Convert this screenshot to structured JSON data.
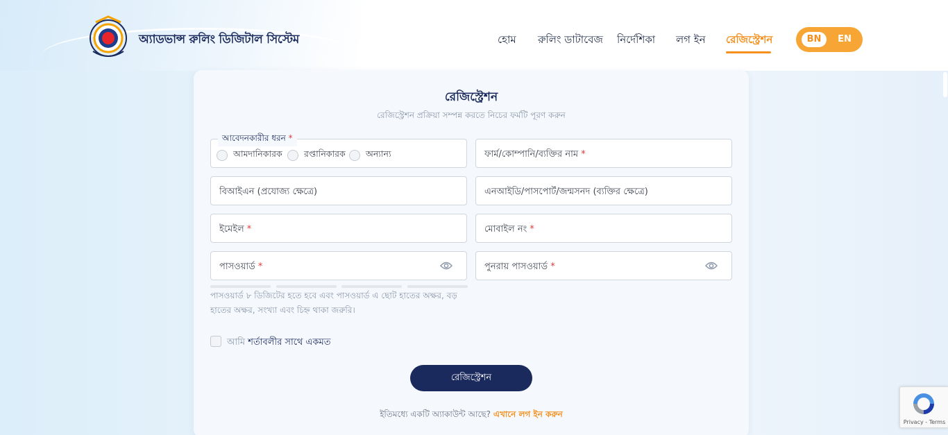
{
  "header": {
    "brand": "অ্যাডভান্স রুলিং ডিজিটাল সিস্টেম",
    "logo_alt": "BANGLADESH CUSTOMS & VAT",
    "nav": [
      {
        "label": "হোম"
      },
      {
        "label": "রুলিং ডাটাবেজ"
      },
      {
        "label": "নির্দেশিকা"
      },
      {
        "label": "লগ ইন"
      },
      {
        "label": "রেজিস্ট্রেশন",
        "active": true
      }
    ],
    "lang": {
      "bn": "BN",
      "en": "EN",
      "selected": "BN"
    }
  },
  "form": {
    "title": "রেজিস্ট্রেশন",
    "subtitle": "রেজিস্ট্রেশন প্রক্রিয়া সম্পন্ন করতে নিচের ফর্মটি পূরণ করুন",
    "applicant_type": {
      "legend": "আবেদনকারীর ধরন",
      "required": "*",
      "options": [
        "আমদানিকারক",
        "রপ্তানিকারক",
        "অন্যান্য"
      ]
    },
    "fields": {
      "name": {
        "label": "ফার্ম/কোম্পানি/ব্যক্তির নাম",
        "required": "*"
      },
      "bin": {
        "label": "বিআইএন (প্রযোজ্য ক্ষেত্রে)"
      },
      "nid": {
        "label": "এনআইডি/পাসপোর্ট/জন্মসনদ (ব্যক্তির ক্ষেত্রে)"
      },
      "email": {
        "label": "ইমেইল",
        "required": "*"
      },
      "mobile": {
        "label": "মোবাইল নং",
        "required": "*"
      },
      "password": {
        "label": "পাসওয়ার্ড",
        "required": "*"
      },
      "confirm_password": {
        "label": "পুনরায় পাসওয়ার্ড",
        "required": "*"
      }
    },
    "password_hint": "পাসওয়ার্ড ৮ ডিজিটের হতে হবে এবং পাসওয়ার্ড এ ছোট হাতের অক্ষর, বড় হাতের অক্ষর, সংখ্যা এবং চিহ্ন থাকা জরুরি।",
    "agree": {
      "prefix": "আমি",
      "link": "শর্তাবলীর সাথে একমত"
    },
    "submit": "রেজিস্ট্রেশন",
    "login_prompt": "ইতিমধ্যে একটি অ্যাকাউন্ট আছে?",
    "login_link": "এখানে লগ ইন করুন"
  },
  "recaptcha": {
    "text": "Privacy - Terms"
  },
  "colors": {
    "accent": "#f4901e",
    "primary": "#1b2a5c",
    "required": "#e23b3b"
  }
}
